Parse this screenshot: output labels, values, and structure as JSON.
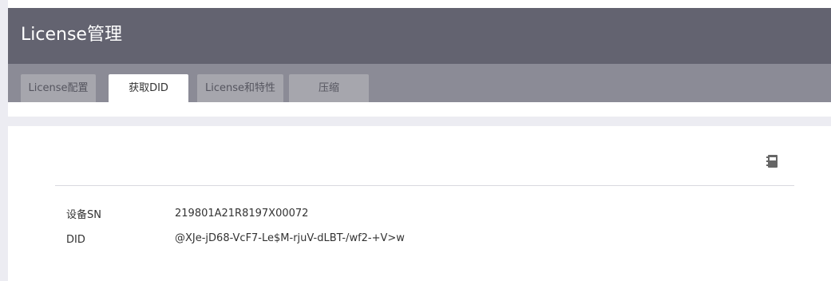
{
  "header": {
    "title": "License管理"
  },
  "tabs": [
    {
      "label": "License配置",
      "active": false
    },
    {
      "label": "获取DID",
      "active": true
    },
    {
      "label": "License和特性",
      "active": false
    },
    {
      "label": "压缩",
      "active": false
    }
  ],
  "info": {
    "device_sn_label": "设备SN",
    "device_sn_value": "219801A21R8197X00072",
    "did_label": "DID",
    "did_value": "@XJe-jD68-VcF7-Le$M-rjuV-dLBT-/wf2-+V>w"
  },
  "icons": {
    "toolbar_icon": "notebook-icon"
  },
  "colors": {
    "title_bar": "#636370",
    "tab_bar": "#8b8b96",
    "inactive_tab": "#a6a6ad",
    "active_tab": "#ffffff",
    "content_band": "#ececf2"
  }
}
